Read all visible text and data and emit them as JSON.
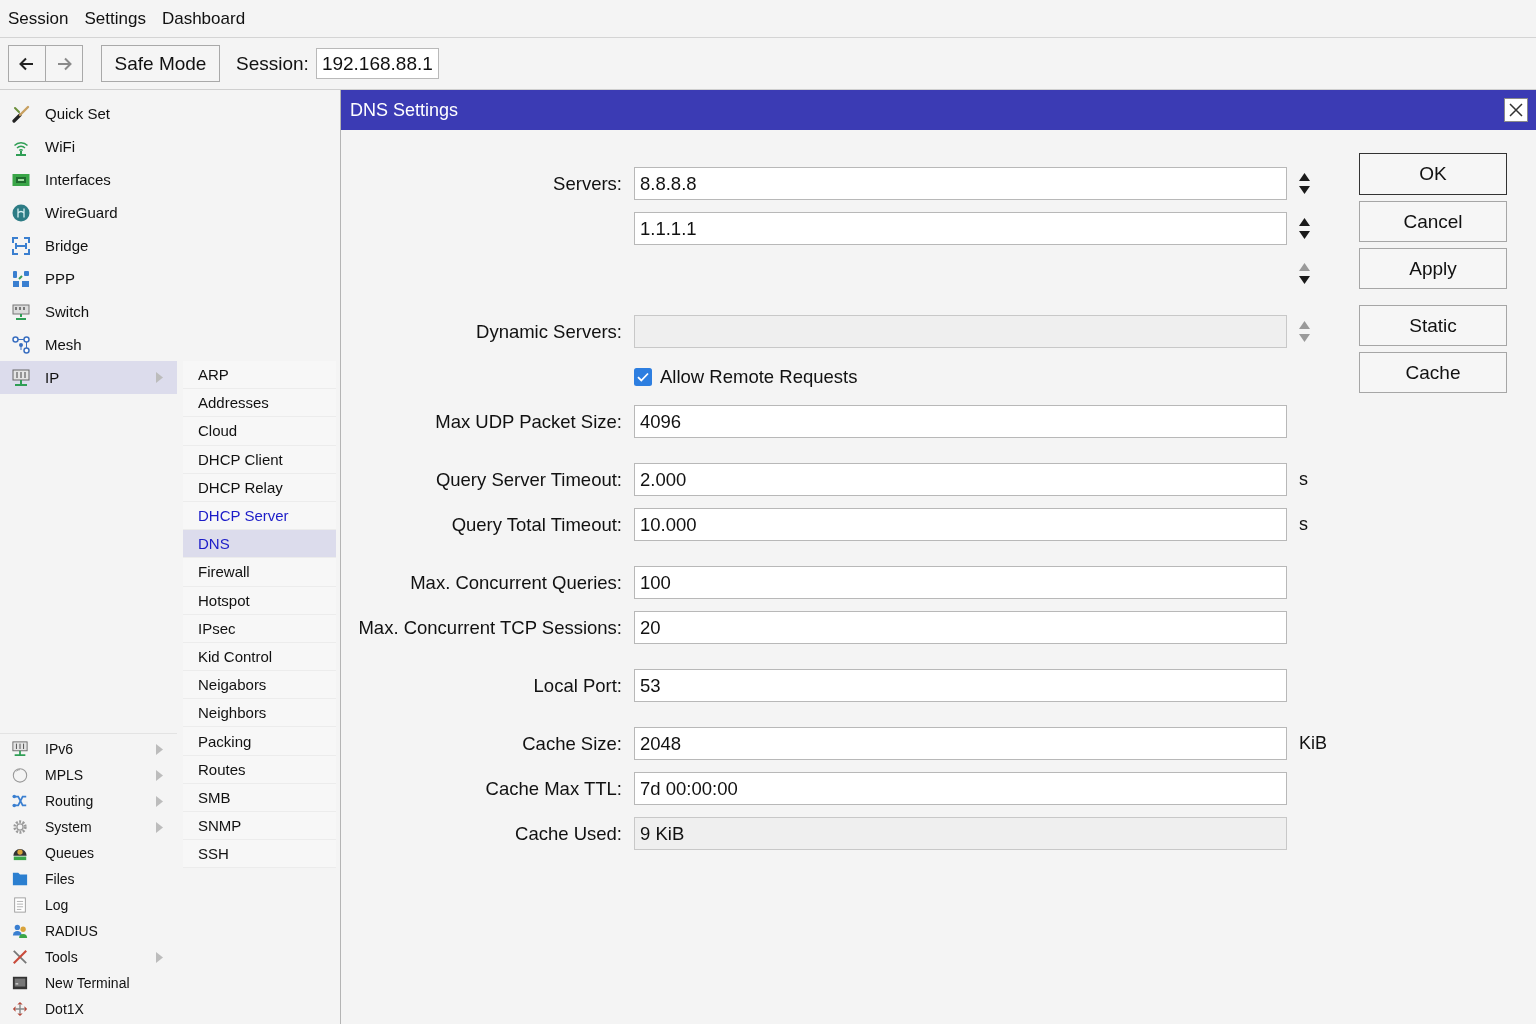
{
  "menu_bar": [
    {
      "label": "Session"
    },
    {
      "label": "Settings"
    },
    {
      "label": "Dashboard"
    }
  ],
  "toolbar": {
    "nav": [
      {
        "kind": "back",
        "enabled": true
      },
      {
        "kind": "forward",
        "enabled": false
      }
    ],
    "safe_mode_button": "Safe Mode",
    "session_label": "Session:",
    "session_value": "192.168.88.1"
  },
  "sidebar": {
    "groups": [
      {
        "items": [
          {
            "label": "Quick Set",
            "has_submenu": false,
            "selected": false
          },
          {
            "label": "WiFi",
            "has_submenu": false,
            "selected": false
          },
          {
            "label": "Interfaces",
            "has_submenu": false,
            "selected": false
          },
          {
            "label": "WireGuard",
            "has_submenu": false,
            "selected": false
          },
          {
            "label": "Bridge",
            "has_submenu": false,
            "selected": false
          },
          {
            "label": "PPP",
            "has_submenu": false,
            "selected": false
          },
          {
            "label": "Switch",
            "has_submenu": false,
            "selected": false
          },
          {
            "label": "Mesh",
            "has_submenu": false,
            "selected": false
          },
          {
            "label": "IP",
            "has_submenu": true,
            "selected": true,
            "submenu": [
              {
                "label": "ARP",
                "selected": false,
                "visited": false
              },
              {
                "label": "Addresses",
                "selected": false,
                "visited": false
              },
              {
                "label": "Cloud",
                "selected": false,
                "visited": false
              },
              {
                "label": "DHCP Client",
                "selected": false,
                "visited": false
              },
              {
                "label": "DHCP Relay",
                "selected": false,
                "visited": false
              },
              {
                "label": "DHCP Server",
                "selected": false,
                "visited": true
              },
              {
                "label": "DNS",
                "selected": true,
                "visited": true
              },
              {
                "label": "Firewall",
                "selected": false,
                "visited": false
              },
              {
                "label": "Hotspot",
                "selected": false,
                "visited": false
              },
              {
                "label": "IPsec",
                "selected": false,
                "visited": false
              },
              {
                "label": "Kid Control",
                "selected": false,
                "visited": false
              },
              {
                "label": "Neigabors",
                "selected": false,
                "visited": false
              },
              {
                "label": "Neighbors",
                "selected": false,
                "visited": false
              },
              {
                "label": "Packing",
                "selected": false,
                "visited": false
              },
              {
                "label": "Routes",
                "selected": false,
                "visited": false
              },
              {
                "label": "SMB",
                "selected": false,
                "visited": false
              },
              {
                "label": "SNMP",
                "selected": false,
                "visited": false
              },
              {
                "label": "SSH",
                "selected": false,
                "visited": false
              }
            ]
          }
        ]
      },
      {
        "items": [
          {
            "label": "IPv6",
            "has_submenu": true,
            "selected": false
          },
          {
            "label": "MPLS",
            "has_submenu": true,
            "selected": false
          },
          {
            "label": "Routing",
            "has_submenu": true,
            "selected": false
          },
          {
            "label": "System",
            "has_submenu": true,
            "selected": false
          },
          {
            "label": "Queues",
            "has_submenu": false,
            "selected": false
          },
          {
            "label": "Files",
            "has_submenu": false,
            "selected": false
          },
          {
            "label": "Log",
            "has_submenu": false,
            "selected": false
          },
          {
            "label": "RADIUS",
            "has_submenu": false,
            "selected": false
          },
          {
            "label": "Tools",
            "has_submenu": true,
            "selected": false
          },
          {
            "label": "New Terminal",
            "has_submenu": false,
            "selected": false
          },
          {
            "label": "Dot1X",
            "has_submenu": false,
            "selected": false
          }
        ]
      }
    ]
  },
  "dialog": {
    "title": "DNS Settings",
    "sections": [
      {
        "rows": [
          {
            "kind": "list_entry",
            "label": "Servers:",
            "value": "8.8.8.8",
            "disabled": false,
            "up_enabled": true,
            "down_enabled": true
          },
          {
            "kind": "list_entry",
            "value": "1.1.1.1",
            "disabled": false,
            "up_enabled": true,
            "down_enabled": true
          },
          {
            "kind": "list_slot",
            "up_enabled": false,
            "down_enabled": true
          }
        ]
      },
      {
        "rows": [
          {
            "kind": "list_entry",
            "label": "Dynamic Servers:",
            "disabled": true,
            "up_enabled": false,
            "down_enabled": false
          },
          {
            "kind": "checkbox",
            "label": "Allow Remote Requests",
            "checked": true
          },
          {
            "kind": "field",
            "label": "Max UDP Packet Size:",
            "value": "4096",
            "disabled": false
          }
        ]
      },
      {
        "rows": [
          {
            "kind": "field",
            "label": "Query Server Timeout:",
            "value": "2.000",
            "disabled": false,
            "unit": "s"
          },
          {
            "kind": "field",
            "label": "Query Total Timeout:",
            "value": "10.000",
            "disabled": false,
            "unit": "s"
          }
        ]
      },
      {
        "rows": [
          {
            "kind": "field",
            "label": "Max. Concurrent Queries:",
            "value": "100",
            "disabled": false
          },
          {
            "kind": "field",
            "label": "Max. Concurrent TCP Sessions:",
            "value": "20",
            "disabled": false
          }
        ]
      },
      {
        "rows": [
          {
            "kind": "field",
            "label": "Local Port:",
            "value": "53",
            "disabled": false
          }
        ]
      },
      {
        "rows": [
          {
            "kind": "field",
            "label": "Cache Size:",
            "value": "2048",
            "disabled": false,
            "unit": "KiB"
          },
          {
            "kind": "field",
            "label": "Cache Max TTL:",
            "value": "7d 00:00:00",
            "disabled": false
          },
          {
            "kind": "field",
            "label": "Cache Used:",
            "value": "9 KiB",
            "disabled": true
          }
        ]
      }
    ],
    "button_groups": [
      {
        "buttons": [
          {
            "label": "OK",
            "default": true
          },
          {
            "label": "Cancel",
            "default": false
          },
          {
            "label": "Apply",
            "default": false
          }
        ]
      },
      {
        "buttons": [
          {
            "label": "Static",
            "default": false
          },
          {
            "label": "Cache",
            "default": false
          }
        ]
      }
    ]
  }
}
